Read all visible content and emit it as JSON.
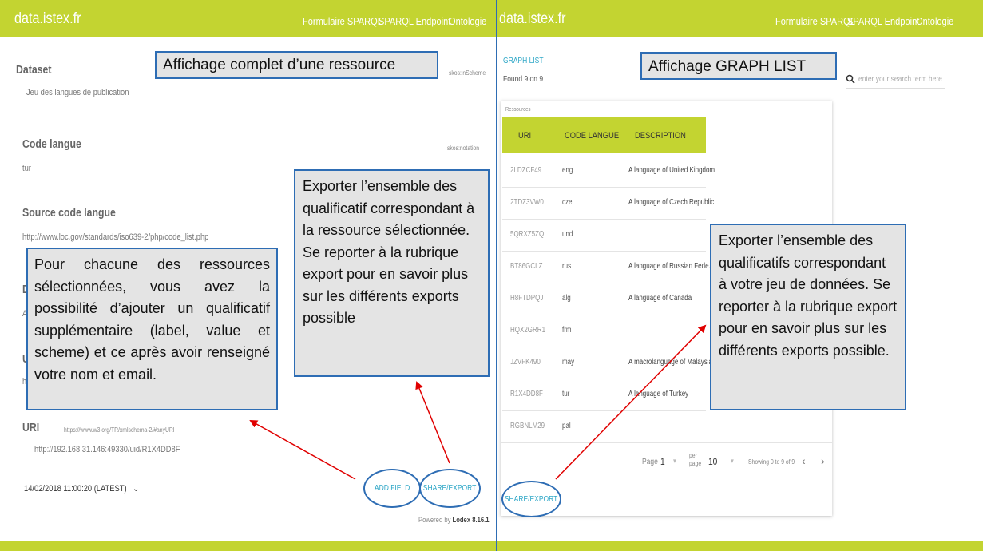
{
  "left_panel": {
    "logo": "data.istex.fr",
    "nav": [
      "Formulaire SPARQL",
      "SPARQL Endpoint",
      "Ontologie"
    ],
    "dataset_label": "Dataset",
    "dataset_value": "Jeu des langues de publication",
    "dataset_scheme": "skos:inScheme",
    "code_langue_label": "Code langue",
    "code_langue_value": "tur",
    "code_langue_scheme": "skos:notation",
    "source_label": "Source code langue",
    "source_value": "http://www.loc.gov/standards/iso639-2/php/code_list.php",
    "partial_d": "D",
    "partial_a": "A",
    "partial_u": "U",
    "partial_h": "h",
    "uri_label": "URI",
    "uri_scheme": "https://www.w3.org/TR/xmlschema-2/#anyURI",
    "uri_value": "http://192.168.31.146:49330/uid/R1X4DD8F",
    "version": "14/02/2018 11:00:20 (LATEST)",
    "add_field": "ADD FIELD",
    "share_export": "SHARE/EXPORT",
    "powered_by": "Powered by",
    "powered_name": "Lodex 8.16.1"
  },
  "right_panel": {
    "logo": "data.istex.fr",
    "nav": [
      "Formulaire SPARQL",
      "SPARQL Endpoint",
      "Ontologie"
    ],
    "graph_list_link": "GRAPH LIST",
    "found": "Found 9 on 9",
    "search_placeholder": "enter your search term here",
    "resources_label": "Ressources",
    "columns": [
      "URI",
      "CODE LANGUE",
      "DESCRIPTION"
    ],
    "rows": [
      {
        "uri": "2LDZCF49",
        "code": "eng",
        "desc": "A language of United Kingdom"
      },
      {
        "uri": "2TDZ3VW0",
        "code": "cze",
        "desc": "A language of Czech Republic"
      },
      {
        "uri": "5QRXZ5ZQ",
        "code": "und",
        "desc": ""
      },
      {
        "uri": "BT86GCLZ",
        "code": "rus",
        "desc": "A language of Russian Fede..."
      },
      {
        "uri": "H8FTDPQJ",
        "code": "alg",
        "desc": "A language of Canada"
      },
      {
        "uri": "HQX2GRR1",
        "code": "frm",
        "desc": ""
      },
      {
        "uri": "JZVFK490",
        "code": "may",
        "desc": "A macrolanguage of Malaysia"
      },
      {
        "uri": "R1X4DD8F",
        "code": "tur",
        "desc": "A language of Turkey"
      },
      {
        "uri": "RGBNLM29",
        "code": "pal",
        "desc": ""
      }
    ],
    "pagination": {
      "page_label": "Page",
      "page_value": "1",
      "per_page_label": "per page",
      "per_page_value": "10",
      "showing": "Showing 0 to 9 of 9",
      "prev": "‹",
      "next": "›"
    },
    "share_export": "SHARE/EXPORT"
  },
  "callouts": {
    "resource_title": "Affichage complet d’une ressource",
    "graph_title": "Affichage GRAPH LIST",
    "add_field_note": "Pour chacune des ressources sélectionnées, vous avez la possibilité d’ajouter un qualificatif supplémentaire (label, value et scheme) et ce après avoir renseigné votre nom et email.",
    "export_resource_note": "Exporter l’ensemble des qualificatif correspondant à la ressource sélectionnée. Se reporter à la rubrique export pour en savoir plus sur les différents exports possible",
    "export_dataset_note": "Exporter l’ensemble des qualificatifs correspondant à votre jeu de données. Se reporter à la rubrique export pour en savoir plus sur les différents exports possible."
  },
  "colors": {
    "brand": "#c3d431",
    "callout_border": "#2e6db4",
    "callout_bg": "#e4e4e4",
    "link": "#2ea7c7",
    "arrow": "#e00000"
  }
}
